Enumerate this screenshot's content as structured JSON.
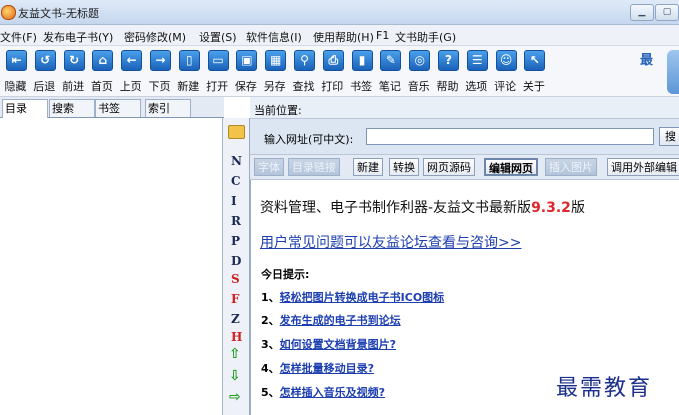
{
  "window": {
    "title": "友益文书-无标题"
  },
  "menu": [
    "文件(F)",
    "发布电子书(Y)",
    "密码修改(M)",
    "设置(S)",
    "软件信息(I)",
    "使用帮助(H)",
    "F1",
    "文书助手(G)"
  ],
  "toolbar": [
    {
      "label": "隐藏",
      "icon": "hide-icon"
    },
    {
      "label": "后退",
      "icon": "back-icon"
    },
    {
      "label": "前进",
      "icon": "forward-icon"
    },
    {
      "label": "首页",
      "icon": "home-icon"
    },
    {
      "label": "上页",
      "icon": "prev-page-icon"
    },
    {
      "label": "下页",
      "icon": "next-page-icon"
    },
    {
      "label": "新建",
      "icon": "new-icon"
    },
    {
      "label": "打开",
      "icon": "open-icon"
    },
    {
      "label": "保存",
      "icon": "save-icon"
    },
    {
      "label": "另存",
      "icon": "save-as-icon"
    },
    {
      "label": "查找",
      "icon": "find-icon"
    },
    {
      "label": "打印",
      "icon": "print-icon"
    },
    {
      "label": "书签",
      "icon": "bookmark-icon"
    },
    {
      "label": "笔记",
      "icon": "note-icon"
    },
    {
      "label": "音乐",
      "icon": "music-icon"
    },
    {
      "label": "帮助",
      "icon": "help-icon"
    },
    {
      "label": "选项",
      "icon": "options-icon"
    },
    {
      "label": "评论",
      "icon": "comment-icon"
    },
    {
      "label": "关于",
      "icon": "about-icon"
    }
  ],
  "toolbar_right_char": "最",
  "left_tabs": [
    "目录",
    "搜索",
    "书签",
    "索引"
  ],
  "side_letters": [
    "N",
    "C",
    "I",
    "R",
    "P",
    "D",
    "S",
    "F",
    "Z",
    "H"
  ],
  "side_letters_red": [
    "S",
    "F",
    "H"
  ],
  "position_label": "当前位置:",
  "url": {
    "label": "输入网址(可中文):",
    "value": "",
    "search_label": "搜"
  },
  "actions": [
    {
      "label": "字体",
      "state": "disabled"
    },
    {
      "label": "目录链接",
      "state": "disabled"
    },
    {
      "label": "新建",
      "state": "normal"
    },
    {
      "label": "转换",
      "state": "normal"
    },
    {
      "label": "网页源码",
      "state": "normal"
    },
    {
      "label": "编辑网页",
      "state": "bold"
    },
    {
      "label": "插入图片",
      "state": "disabled"
    },
    {
      "label": "调用外部编辑",
      "state": "normal"
    }
  ],
  "content": {
    "headline_main": "资料管理、电子书制作利器-友益文书最新版",
    "headline_version": "9.3.2",
    "headline_suffix": "版",
    "faq_link": "用户常见问题可以友益论坛查看与咨询>>",
    "tips_title": "今日提示:",
    "tips": [
      {
        "num": "1、",
        "text": "轻松把图片转换成电子书ICO图标"
      },
      {
        "num": "2、",
        "text": "发布生成的电子书到论坛"
      },
      {
        "num": "3、",
        "text": "如何设置文档背景图片?"
      },
      {
        "num": "4、",
        "text": "怎样批量移动目录?"
      },
      {
        "num": "5、",
        "text": "怎样插入音乐及视频?"
      }
    ],
    "watermark": "最需教育"
  }
}
